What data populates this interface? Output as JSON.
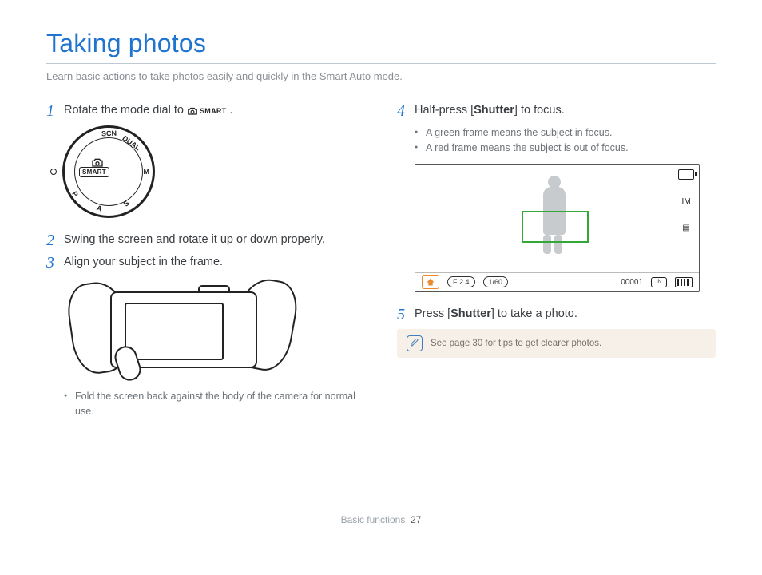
{
  "title": "Taking photos",
  "subtitle": "Learn basic actions to take photos easily and quickly in the Smart Auto mode.",
  "smart_label": "SMART",
  "dial": {
    "scn": "SCN",
    "dual": "DUAL",
    "m": "M",
    "s": "S",
    "a": "A",
    "p": "P"
  },
  "steps": {
    "s1": {
      "num": "1",
      "pre": "Rotate the mode dial to ",
      "post": "."
    },
    "s2": {
      "num": "2",
      "text": "Swing the screen and rotate it up or down properly."
    },
    "s3": {
      "num": "3",
      "text": "Align your subject in the frame."
    },
    "s3_bullet": "Fold the screen back against the body of the camera for normal use.",
    "s4": {
      "num": "4",
      "pre": "Half-press [",
      "bold": "Shutter",
      "post": "] to focus."
    },
    "s4_bullets": {
      "a": "A green frame means the subject in focus.",
      "b": "A red frame means the subject is out of focus."
    },
    "s5": {
      "num": "5",
      "pre": "Press [",
      "bold": "Shutter",
      "post": "] to take a photo."
    }
  },
  "preview": {
    "size_icon": "IM",
    "aperture": "F 2.4",
    "shutter": "1/60",
    "counter": "00001",
    "storage": "IN"
  },
  "tip": "See page 30 for tips to get clearer photos.",
  "footer": {
    "section": "Basic functions",
    "page": "27"
  }
}
